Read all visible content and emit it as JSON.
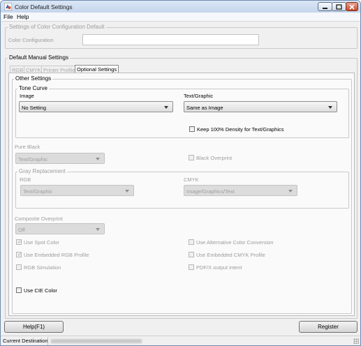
{
  "window": {
    "title": "Color Default Settings"
  },
  "menu": {
    "file": "File",
    "help": "Help"
  },
  "color_config_group": {
    "title": "Settings of Color Configuration Default",
    "label": "Color Configuration",
    "value": ""
  },
  "manual_group": {
    "title": "Default Manual Settings"
  },
  "tabs": [
    "RGB",
    "CMYK",
    "Printer Profile",
    "Optional Settings"
  ],
  "active_tab": "Optional Settings",
  "other_settings": {
    "title": "Other Settings",
    "tone_curve": {
      "title": "Tone Curve",
      "image_label": "Image",
      "image_value": "No Setting",
      "textgraphic_label": "Text/Graphic",
      "textgraphic_value": "Same as Image",
      "keep_density_label": "Keep 100% Density for Text/Graphics",
      "keep_density_checked": false
    },
    "pure_black": {
      "label": "Pure Black",
      "value": "Text/Graphic",
      "black_overprint_label": "Black Overprint",
      "black_overprint_checked": false
    },
    "gray_replacement": {
      "title": "Gray Replacement",
      "rgb_label": "RGB",
      "rgb_value": "Text/Graphic",
      "cmyk_label": "CMYK",
      "cmyk_value": "Image/Graphics/Text"
    },
    "composite_overprint": {
      "label": "Composite Overprint",
      "value": "Off"
    },
    "checkboxes": {
      "use_spot_color": {
        "label": "Use Spot Color",
        "checked": true
      },
      "use_alt_color_conversion": {
        "label": "Use Alternative Color Conversion",
        "checked": false
      },
      "use_embedded_rgb": {
        "label": "Use Embedded RGB Profile",
        "checked": true
      },
      "use_embedded_cmyk": {
        "label": "Use Embedded CMYK Profile",
        "checked": false
      },
      "rgb_simulation": {
        "label": "RGB Simulation",
        "checked": false
      },
      "pdfx_output_intent": {
        "label": "PDF/X output intent",
        "checked": false
      },
      "use_cie_color": {
        "label": "Use CIE Color",
        "checked": false
      }
    }
  },
  "buttons": {
    "help": "Help(F1)",
    "register": "Register"
  },
  "status": {
    "label": "Current Destination"
  }
}
